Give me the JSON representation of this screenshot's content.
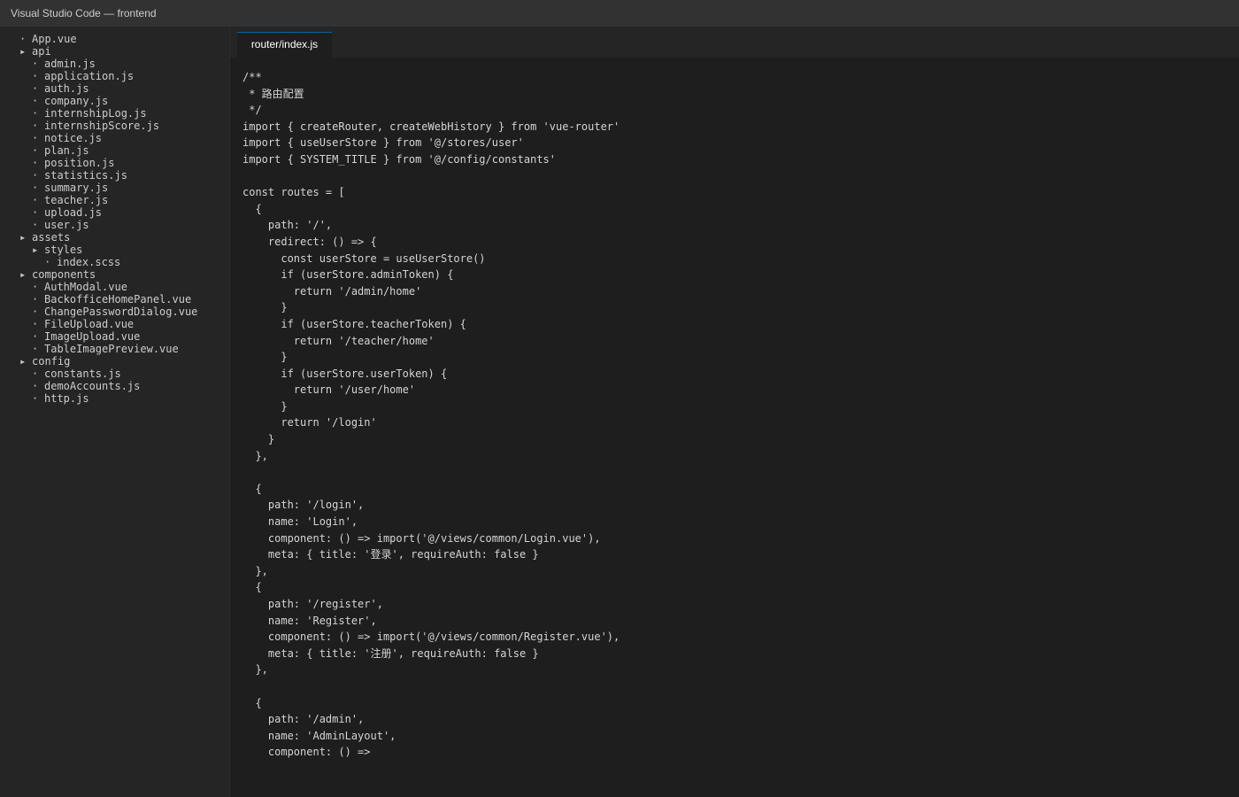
{
  "window": {
    "title": "Visual Studio Code — frontend"
  },
  "explorer": {
    "items": [
      {
        "label": "App.vue",
        "type": "file",
        "depth": 0
      },
      {
        "label": "api",
        "type": "folder",
        "depth": 0
      },
      {
        "label": "admin.js",
        "type": "file",
        "depth": 1
      },
      {
        "label": "application.js",
        "type": "file",
        "depth": 1
      },
      {
        "label": "auth.js",
        "type": "file",
        "depth": 1
      },
      {
        "label": "company.js",
        "type": "file",
        "depth": 1
      },
      {
        "label": "internshipLog.js",
        "type": "file",
        "depth": 1
      },
      {
        "label": "internshipScore.js",
        "type": "file",
        "depth": 1
      },
      {
        "label": "notice.js",
        "type": "file",
        "depth": 1
      },
      {
        "label": "plan.js",
        "type": "file",
        "depth": 1
      },
      {
        "label": "position.js",
        "type": "file",
        "depth": 1
      },
      {
        "label": "statistics.js",
        "type": "file",
        "depth": 1
      },
      {
        "label": "summary.js",
        "type": "file",
        "depth": 1
      },
      {
        "label": "teacher.js",
        "type": "file",
        "depth": 1
      },
      {
        "label": "upload.js",
        "type": "file",
        "depth": 1
      },
      {
        "label": "user.js",
        "type": "file",
        "depth": 1
      },
      {
        "label": "assets",
        "type": "folder",
        "depth": 0
      },
      {
        "label": "styles",
        "type": "folder",
        "depth": 1
      },
      {
        "label": "index.scss",
        "type": "file",
        "depth": 2
      },
      {
        "label": "components",
        "type": "folder",
        "depth": 0
      },
      {
        "label": "AuthModal.vue",
        "type": "file",
        "depth": 1
      },
      {
        "label": "BackofficeHomePanel.vue",
        "type": "file",
        "depth": 1
      },
      {
        "label": "ChangePasswordDialog.vue",
        "type": "file",
        "depth": 1
      },
      {
        "label": "FileUpload.vue",
        "type": "file",
        "depth": 1
      },
      {
        "label": "ImageUpload.vue",
        "type": "file",
        "depth": 1
      },
      {
        "label": "TableImagePreview.vue",
        "type": "file",
        "depth": 1
      },
      {
        "label": "config",
        "type": "folder",
        "depth": 0
      },
      {
        "label": "constants.js",
        "type": "file",
        "depth": 1
      },
      {
        "label": "demoAccounts.js",
        "type": "file",
        "depth": 1
      },
      {
        "label": "http.js",
        "type": "file",
        "depth": 1
      }
    ]
  },
  "editor": {
    "active_tab": "router/index.js",
    "code": "/**\n * 路由配置\n */\nimport { createRouter, createWebHistory } from 'vue-router'\nimport { useUserStore } from '@/stores/user'\nimport { SYSTEM_TITLE } from '@/config/constants'\n\nconst routes = [\n  {\n    path: '/',\n    redirect: () => {\n      const userStore = useUserStore()\n      if (userStore.adminToken) {\n        return '/admin/home'\n      }\n      if (userStore.teacherToken) {\n        return '/teacher/home'\n      }\n      if (userStore.userToken) {\n        return '/user/home'\n      }\n      return '/login'\n    }\n  },\n\n  {\n    path: '/login',\n    name: 'Login',\n    component: () => import('@/views/common/Login.vue'),\n    meta: { title: '登录', requireAuth: false }\n  },\n  {\n    path: '/register',\n    name: 'Register',\n    component: () => import('@/views/common/Register.vue'),\n    meta: { title: '注册', requireAuth: false }\n  },\n\n  {\n    path: '/admin',\n    name: 'AdminLayout',\n    component: () =>"
  },
  "colors": {
    "editor_bg": "#1e1e1e",
    "sidebar_bg": "#252526",
    "titlebar_bg": "#323233",
    "text": "#d4d4d4",
    "tab_border": "#0e639c"
  }
}
